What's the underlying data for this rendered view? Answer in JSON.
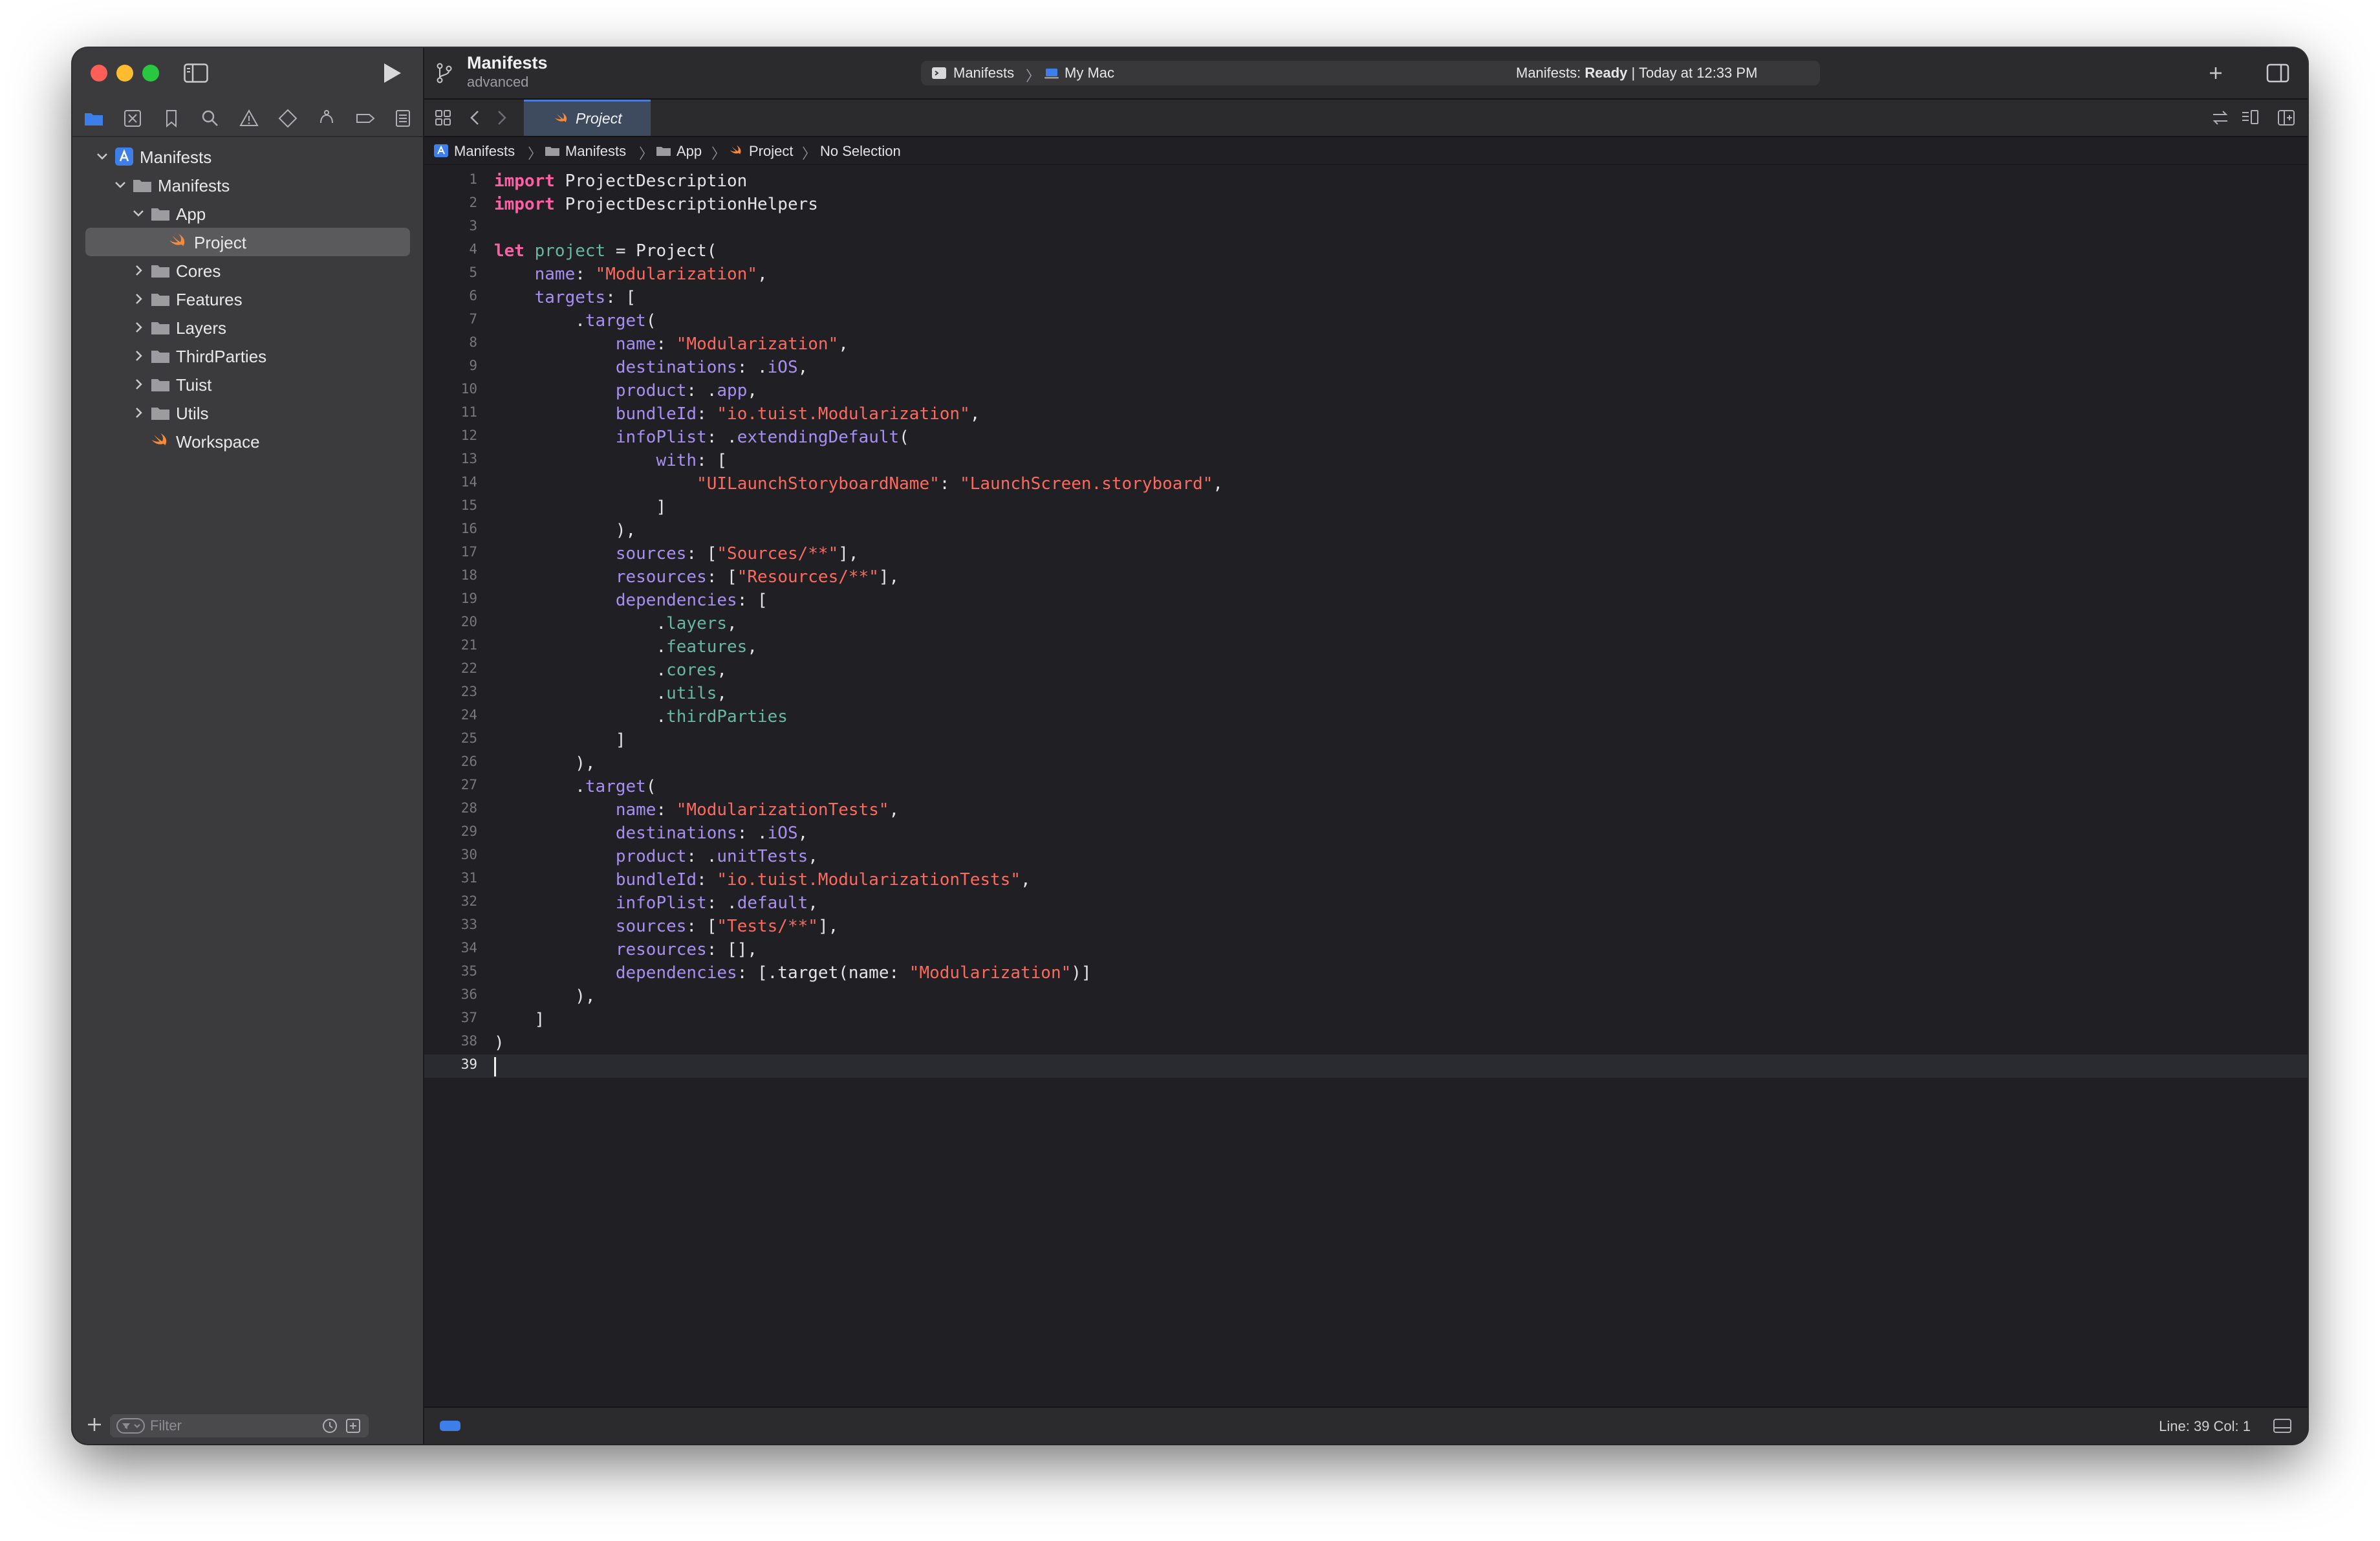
{
  "window": {
    "project_title": "Manifests",
    "project_subtitle": "advanced"
  },
  "scheme": {
    "target": "Manifests",
    "destination": "My Mac",
    "status_prefix": "Manifests: ",
    "status_state": "Ready",
    "status_suffix": " | Today at 12:33 PM"
  },
  "navigator": {
    "tree": [
      {
        "label": "Manifests",
        "depth": 0,
        "expanded": true,
        "icon": "project-icon"
      },
      {
        "label": "Manifests",
        "depth": 1,
        "expanded": true,
        "icon": "folder-icon"
      },
      {
        "label": "App",
        "depth": 2,
        "expanded": true,
        "icon": "folder-icon"
      },
      {
        "label": "Project",
        "depth": 3,
        "selected": true,
        "icon": "swift-file-icon"
      },
      {
        "label": "Cores",
        "depth": 2,
        "expanded": false,
        "icon": "folder-icon"
      },
      {
        "label": "Features",
        "depth": 2,
        "expanded": false,
        "icon": "folder-icon"
      },
      {
        "label": "Layers",
        "depth": 2,
        "expanded": false,
        "icon": "folder-icon"
      },
      {
        "label": "ThirdParties",
        "depth": 2,
        "expanded": false,
        "icon": "folder-icon"
      },
      {
        "label": "Tuist",
        "depth": 2,
        "expanded": false,
        "icon": "folder-icon"
      },
      {
        "label": "Utils",
        "depth": 2,
        "expanded": false,
        "icon": "folder-icon"
      },
      {
        "label": "Workspace",
        "depth": 2,
        "icon": "swift-file-icon"
      }
    ],
    "filter_placeholder": "Filter"
  },
  "editor": {
    "tab_label": "Project",
    "jumpbar": [
      "Manifests",
      "Manifests",
      "App",
      "Project",
      "No Selection"
    ],
    "lines": [
      [
        [
          "kw",
          "import"
        ],
        [
          "plain",
          " ProjectDescription"
        ]
      ],
      [
        [
          "kw",
          "import"
        ],
        [
          "plain",
          " ProjectDescriptionHelpers"
        ]
      ],
      [],
      [
        [
          "kw",
          "let"
        ],
        [
          "plain",
          " "
        ],
        [
          "ctor",
          "project"
        ],
        [
          "plain",
          " = Project("
        ]
      ],
      [
        [
          "plain",
          "    "
        ],
        [
          "prop",
          "name"
        ],
        [
          "plain",
          ": "
        ],
        [
          "str",
          "\"Modularization\""
        ],
        [
          "plain",
          ","
        ]
      ],
      [
        [
          "plain",
          "    "
        ],
        [
          "prop",
          "targets"
        ],
        [
          "plain",
          ": ["
        ]
      ],
      [
        [
          "plain",
          "        ."
        ],
        [
          "prop",
          "target"
        ],
        [
          "plain",
          "("
        ]
      ],
      [
        [
          "plain",
          "            "
        ],
        [
          "prop",
          "name"
        ],
        [
          "plain",
          ": "
        ],
        [
          "str",
          "\"Modularization\""
        ],
        [
          "plain",
          ","
        ]
      ],
      [
        [
          "plain",
          "            "
        ],
        [
          "prop",
          "destinations"
        ],
        [
          "plain",
          ": ."
        ],
        [
          "prop",
          "iOS"
        ],
        [
          "plain",
          ","
        ]
      ],
      [
        [
          "plain",
          "            "
        ],
        [
          "prop",
          "product"
        ],
        [
          "plain",
          ": ."
        ],
        [
          "prop",
          "app"
        ],
        [
          "plain",
          ","
        ]
      ],
      [
        [
          "plain",
          "            "
        ],
        [
          "prop",
          "bundleId"
        ],
        [
          "plain",
          ": "
        ],
        [
          "str",
          "\"io.tuist.Modularization\""
        ],
        [
          "plain",
          ","
        ]
      ],
      [
        [
          "plain",
          "            "
        ],
        [
          "prop",
          "infoPlist"
        ],
        [
          "plain",
          ": ."
        ],
        [
          "prop",
          "extendingDefault"
        ],
        [
          "plain",
          "("
        ]
      ],
      [
        [
          "plain",
          "                "
        ],
        [
          "prop",
          "with"
        ],
        [
          "plain",
          ": ["
        ]
      ],
      [
        [
          "plain",
          "                    "
        ],
        [
          "str",
          "\"UILaunchStoryboardName\""
        ],
        [
          "plain",
          ": "
        ],
        [
          "str",
          "\"LaunchScreen.storyboard\""
        ],
        [
          "plain",
          ","
        ]
      ],
      [
        [
          "plain",
          "                ]"
        ]
      ],
      [
        [
          "plain",
          "            ),"
        ]
      ],
      [
        [
          "plain",
          "            "
        ],
        [
          "prop",
          "sources"
        ],
        [
          "plain",
          ": ["
        ],
        [
          "str",
          "\"Sources/**\""
        ],
        [
          "plain",
          "],"
        ]
      ],
      [
        [
          "plain",
          "            "
        ],
        [
          "prop",
          "resources"
        ],
        [
          "plain",
          ": ["
        ],
        [
          "str",
          "\"Resources/**\""
        ],
        [
          "plain",
          "],"
        ]
      ],
      [
        [
          "plain",
          "            "
        ],
        [
          "prop",
          "dependencies"
        ],
        [
          "plain",
          ": ["
        ]
      ],
      [
        [
          "plain",
          "                ."
        ],
        [
          "ctor",
          "layers"
        ],
        [
          "plain",
          ","
        ]
      ],
      [
        [
          "plain",
          "                ."
        ],
        [
          "ctor",
          "features"
        ],
        [
          "plain",
          ","
        ]
      ],
      [
        [
          "plain",
          "                ."
        ],
        [
          "ctor",
          "cores"
        ],
        [
          "plain",
          ","
        ]
      ],
      [
        [
          "plain",
          "                ."
        ],
        [
          "ctor",
          "utils"
        ],
        [
          "plain",
          ","
        ]
      ],
      [
        [
          "plain",
          "                ."
        ],
        [
          "ctor",
          "thirdParties"
        ]
      ],
      [
        [
          "plain",
          "            ]"
        ]
      ],
      [
        [
          "plain",
          "        ),"
        ]
      ],
      [
        [
          "plain",
          "        ."
        ],
        [
          "prop",
          "target"
        ],
        [
          "plain",
          "("
        ]
      ],
      [
        [
          "plain",
          "            "
        ],
        [
          "prop",
          "name"
        ],
        [
          "plain",
          ": "
        ],
        [
          "str",
          "\"ModularizationTests\""
        ],
        [
          "plain",
          ","
        ]
      ],
      [
        [
          "plain",
          "            "
        ],
        [
          "prop",
          "destinations"
        ],
        [
          "plain",
          ": ."
        ],
        [
          "prop",
          "iOS"
        ],
        [
          "plain",
          ","
        ]
      ],
      [
        [
          "plain",
          "            "
        ],
        [
          "prop",
          "product"
        ],
        [
          "plain",
          ": ."
        ],
        [
          "prop",
          "unitTests"
        ],
        [
          "plain",
          ","
        ]
      ],
      [
        [
          "plain",
          "            "
        ],
        [
          "prop",
          "bundleId"
        ],
        [
          "plain",
          ": "
        ],
        [
          "str",
          "\"io.tuist.ModularizationTests\""
        ],
        [
          "plain",
          ","
        ]
      ],
      [
        [
          "plain",
          "            "
        ],
        [
          "prop",
          "infoPlist"
        ],
        [
          "plain",
          ": ."
        ],
        [
          "prop",
          "default"
        ],
        [
          "plain",
          ","
        ]
      ],
      [
        [
          "plain",
          "            "
        ],
        [
          "prop",
          "sources"
        ],
        [
          "plain",
          ": ["
        ],
        [
          "str",
          "\"Tests/**\""
        ],
        [
          "plain",
          "],"
        ]
      ],
      [
        [
          "plain",
          "            "
        ],
        [
          "prop",
          "resources"
        ],
        [
          "plain",
          ": [],"
        ]
      ],
      [
        [
          "plain",
          "            "
        ],
        [
          "prop",
          "dependencies"
        ],
        [
          "plain",
          ": [.target(name: "
        ],
        [
          "str",
          "\"Modularization\""
        ],
        [
          "plain",
          ")]"
        ]
      ],
      [
        [
          "plain",
          "        ),"
        ]
      ],
      [
        [
          "plain",
          "    ]"
        ]
      ],
      [
        [
          "plain",
          ")"
        ]
      ],
      []
    ],
    "current_line": 39
  },
  "status": {
    "position": "Line: 39  Col: 1"
  },
  "colors": {
    "accent": "#3d7ee8",
    "keyword": "#fc5fa3",
    "string": "#fc6a5d",
    "property": "#a88ff0",
    "member": "#67b7a4",
    "editor_bg": "#1f1f24",
    "sidebar_bg": "#3b3b3d"
  }
}
